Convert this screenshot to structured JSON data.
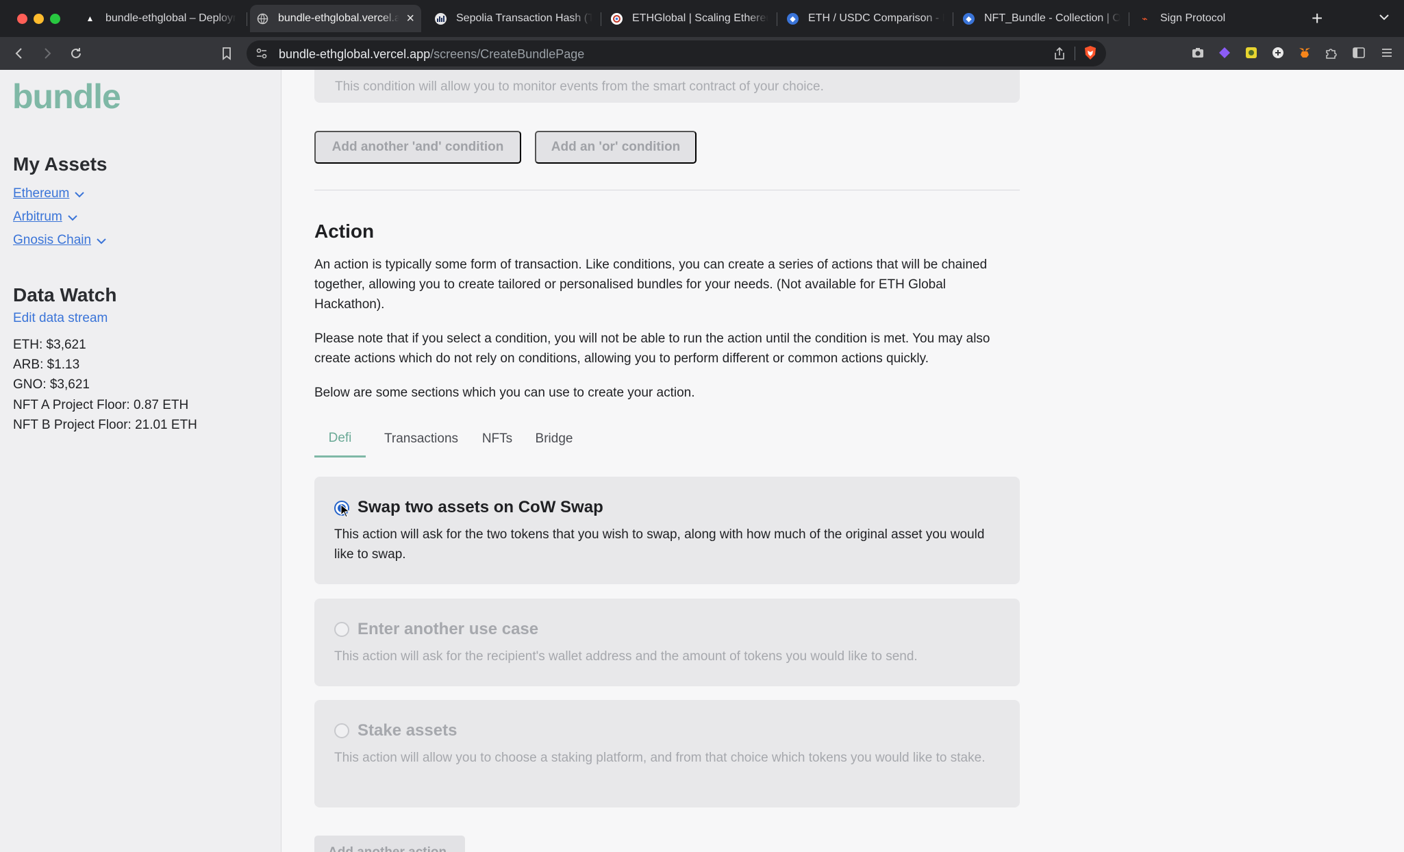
{
  "browser": {
    "tabs": [
      {
        "title": "bundle-ethglobal – Deployments",
        "favicon_color": "#000000",
        "favicon": "triangle-icon"
      },
      {
        "title": "bundle-ethglobal.vercel.app",
        "favicon_color": "#5f6368",
        "favicon": "globe-icon",
        "active": true
      },
      {
        "title": "Sepolia Transaction Hash (Txhash)",
        "favicon_color": "#21325b",
        "favicon": "etherscan-icon"
      },
      {
        "title": "ETHGlobal | Scaling Ethereum",
        "favicon_color": "#ffffff",
        "favicon": "ethglobal-icon"
      },
      {
        "title": "ETH / USDC Comparison - Bundle",
        "favicon_color": "#3a74d8",
        "favicon": "bundle-icon"
      },
      {
        "title": "NFT_Bundle - Collection | OpenSea",
        "favicon_color": "#3a74d8",
        "favicon": "bundle-icon"
      },
      {
        "title": "Sign Protocol",
        "favicon_color": "#ff5a2b",
        "favicon": "sign-icon"
      }
    ],
    "url_host": "bundle-ethglobal.vercel.app",
    "url_path": "/screens/CreateBundlePage"
  },
  "sidebar": {
    "logo": "bundle",
    "assets_heading": "My Assets",
    "assets": [
      "Ethereum",
      "Arbitrum",
      "Gnosis Chain"
    ],
    "watch_heading": "Data Watch",
    "edit_link": "Edit data stream",
    "watch_items": [
      "ETH: $3,621",
      "ARB: $1.13",
      "GNO: $3,621",
      "NFT A Project Floor: 0.87 ETH",
      "NFT B Project Floor: 21.01 ETH"
    ]
  },
  "main": {
    "condition_text": "This condition will allow you to monitor events from the smart contract of your choice.",
    "and_button": "Add another 'and' condition",
    "or_button": "Add an 'or' condition",
    "action_title": "Action",
    "para1": "An action is typically some form of transaction. Like conditions, you can create a series of actions that will be chained together, allowing you to create tailored or personalised bundles for your needs. (Not available for ETH Global Hackathon).",
    "para2": "Please note that if you select a condition, you will not be able to run the action until the condition is met. You may also create actions which do not rely on conditions, allowing you to perform different or common actions quickly.",
    "para3": "Below are some sections which you can use to create your action.",
    "tabs": [
      "Defi",
      "Transactions",
      "NFTs",
      "Bridge"
    ],
    "active_tab": "Defi",
    "options": [
      {
        "title": "Swap two assets on CoW Swap",
        "desc": "This action will ask for the two tokens that you wish to swap, along with how much of the original asset you would like to swap.",
        "selected": true
      },
      {
        "title": "Enter another use case",
        "desc": "This action will ask for the recipient's wallet address and the amount of tokens you would like to send.",
        "selected": false
      },
      {
        "title": "Stake assets",
        "desc": "This action will allow you to choose a staking platform, and from that choice which tokens you would like to stake.",
        "selected": false
      }
    ],
    "add_action_button": "Add another action"
  },
  "colors": {
    "accent": "#7fb8a6",
    "link": "#3a74d8",
    "radio_selected": "#2563c9"
  }
}
